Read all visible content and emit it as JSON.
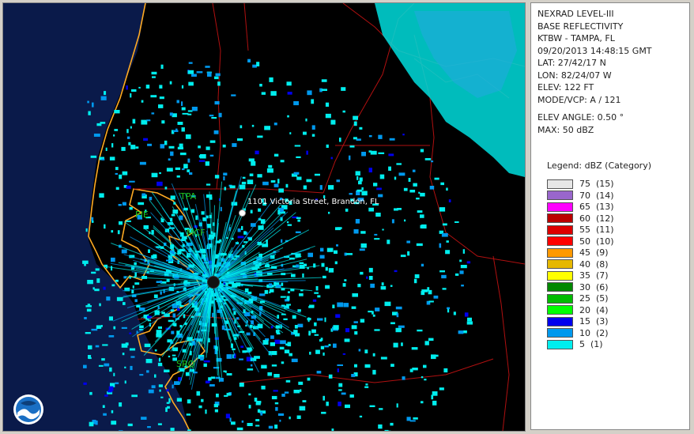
{
  "info": {
    "product": "NEXRAD LEVEL-III",
    "type": "BASE REFLECTIVITY",
    "station": "KTBW - TAMPA, FL",
    "datetime": "09/20/2013 14:48:15 GMT",
    "lat": "LAT: 27/42/17 N",
    "lon": "LON: 82/24/07 W",
    "elev": "ELEV: 122 FT",
    "mode": "MODE/VCP: A / 121",
    "elev_angle": "ELEV ANGLE: 0.50 °",
    "max": "MAX: 50 dBZ"
  },
  "legend": {
    "title": "Legend: dBZ (Category)",
    "items": [
      {
        "text": "75  (15)",
        "color": "#e6e6e6"
      },
      {
        "text": "70  (14)",
        "color": "#9966cc"
      },
      {
        "text": "65  (13)",
        "color": "#ff00ff"
      },
      {
        "text": "60  (12)",
        "color": "#bb0000"
      },
      {
        "text": "55  (11)",
        "color": "#dd0000"
      },
      {
        "text": "50  (10)",
        "color": "#ff0000"
      },
      {
        "text": "45  (9)",
        "color": "#ff9900"
      },
      {
        "text": "40  (8)",
        "color": "#e6b800"
      },
      {
        "text": "35  (7)",
        "color": "#ffff00"
      },
      {
        "text": "30  (6)",
        "color": "#008800"
      },
      {
        "text": "25  (5)",
        "color": "#00bb00"
      },
      {
        "text": "20  (4)",
        "color": "#00ff00"
      },
      {
        "text": "15  (3)",
        "color": "#0000ee"
      },
      {
        "text": "10  (2)",
        "color": "#0099ee"
      },
      {
        "text": "5  (1)",
        "color": "#00eeee"
      }
    ]
  },
  "map": {
    "cities": {
      "tpa": "TPA",
      "pie": "PIE",
      "mcf": "MCF",
      "sro": "SRQ"
    },
    "address": "1101 Victoria Street, Brandon, FL",
    "colors": {
      "gulf": "#0a1a4a",
      "land": "#000000",
      "coast": "#ffaa22",
      "county": "#b01010",
      "echo_light": "#00eeee",
      "echo_mid": "#0099ee",
      "echo_strong": "#0000ee"
    }
  }
}
